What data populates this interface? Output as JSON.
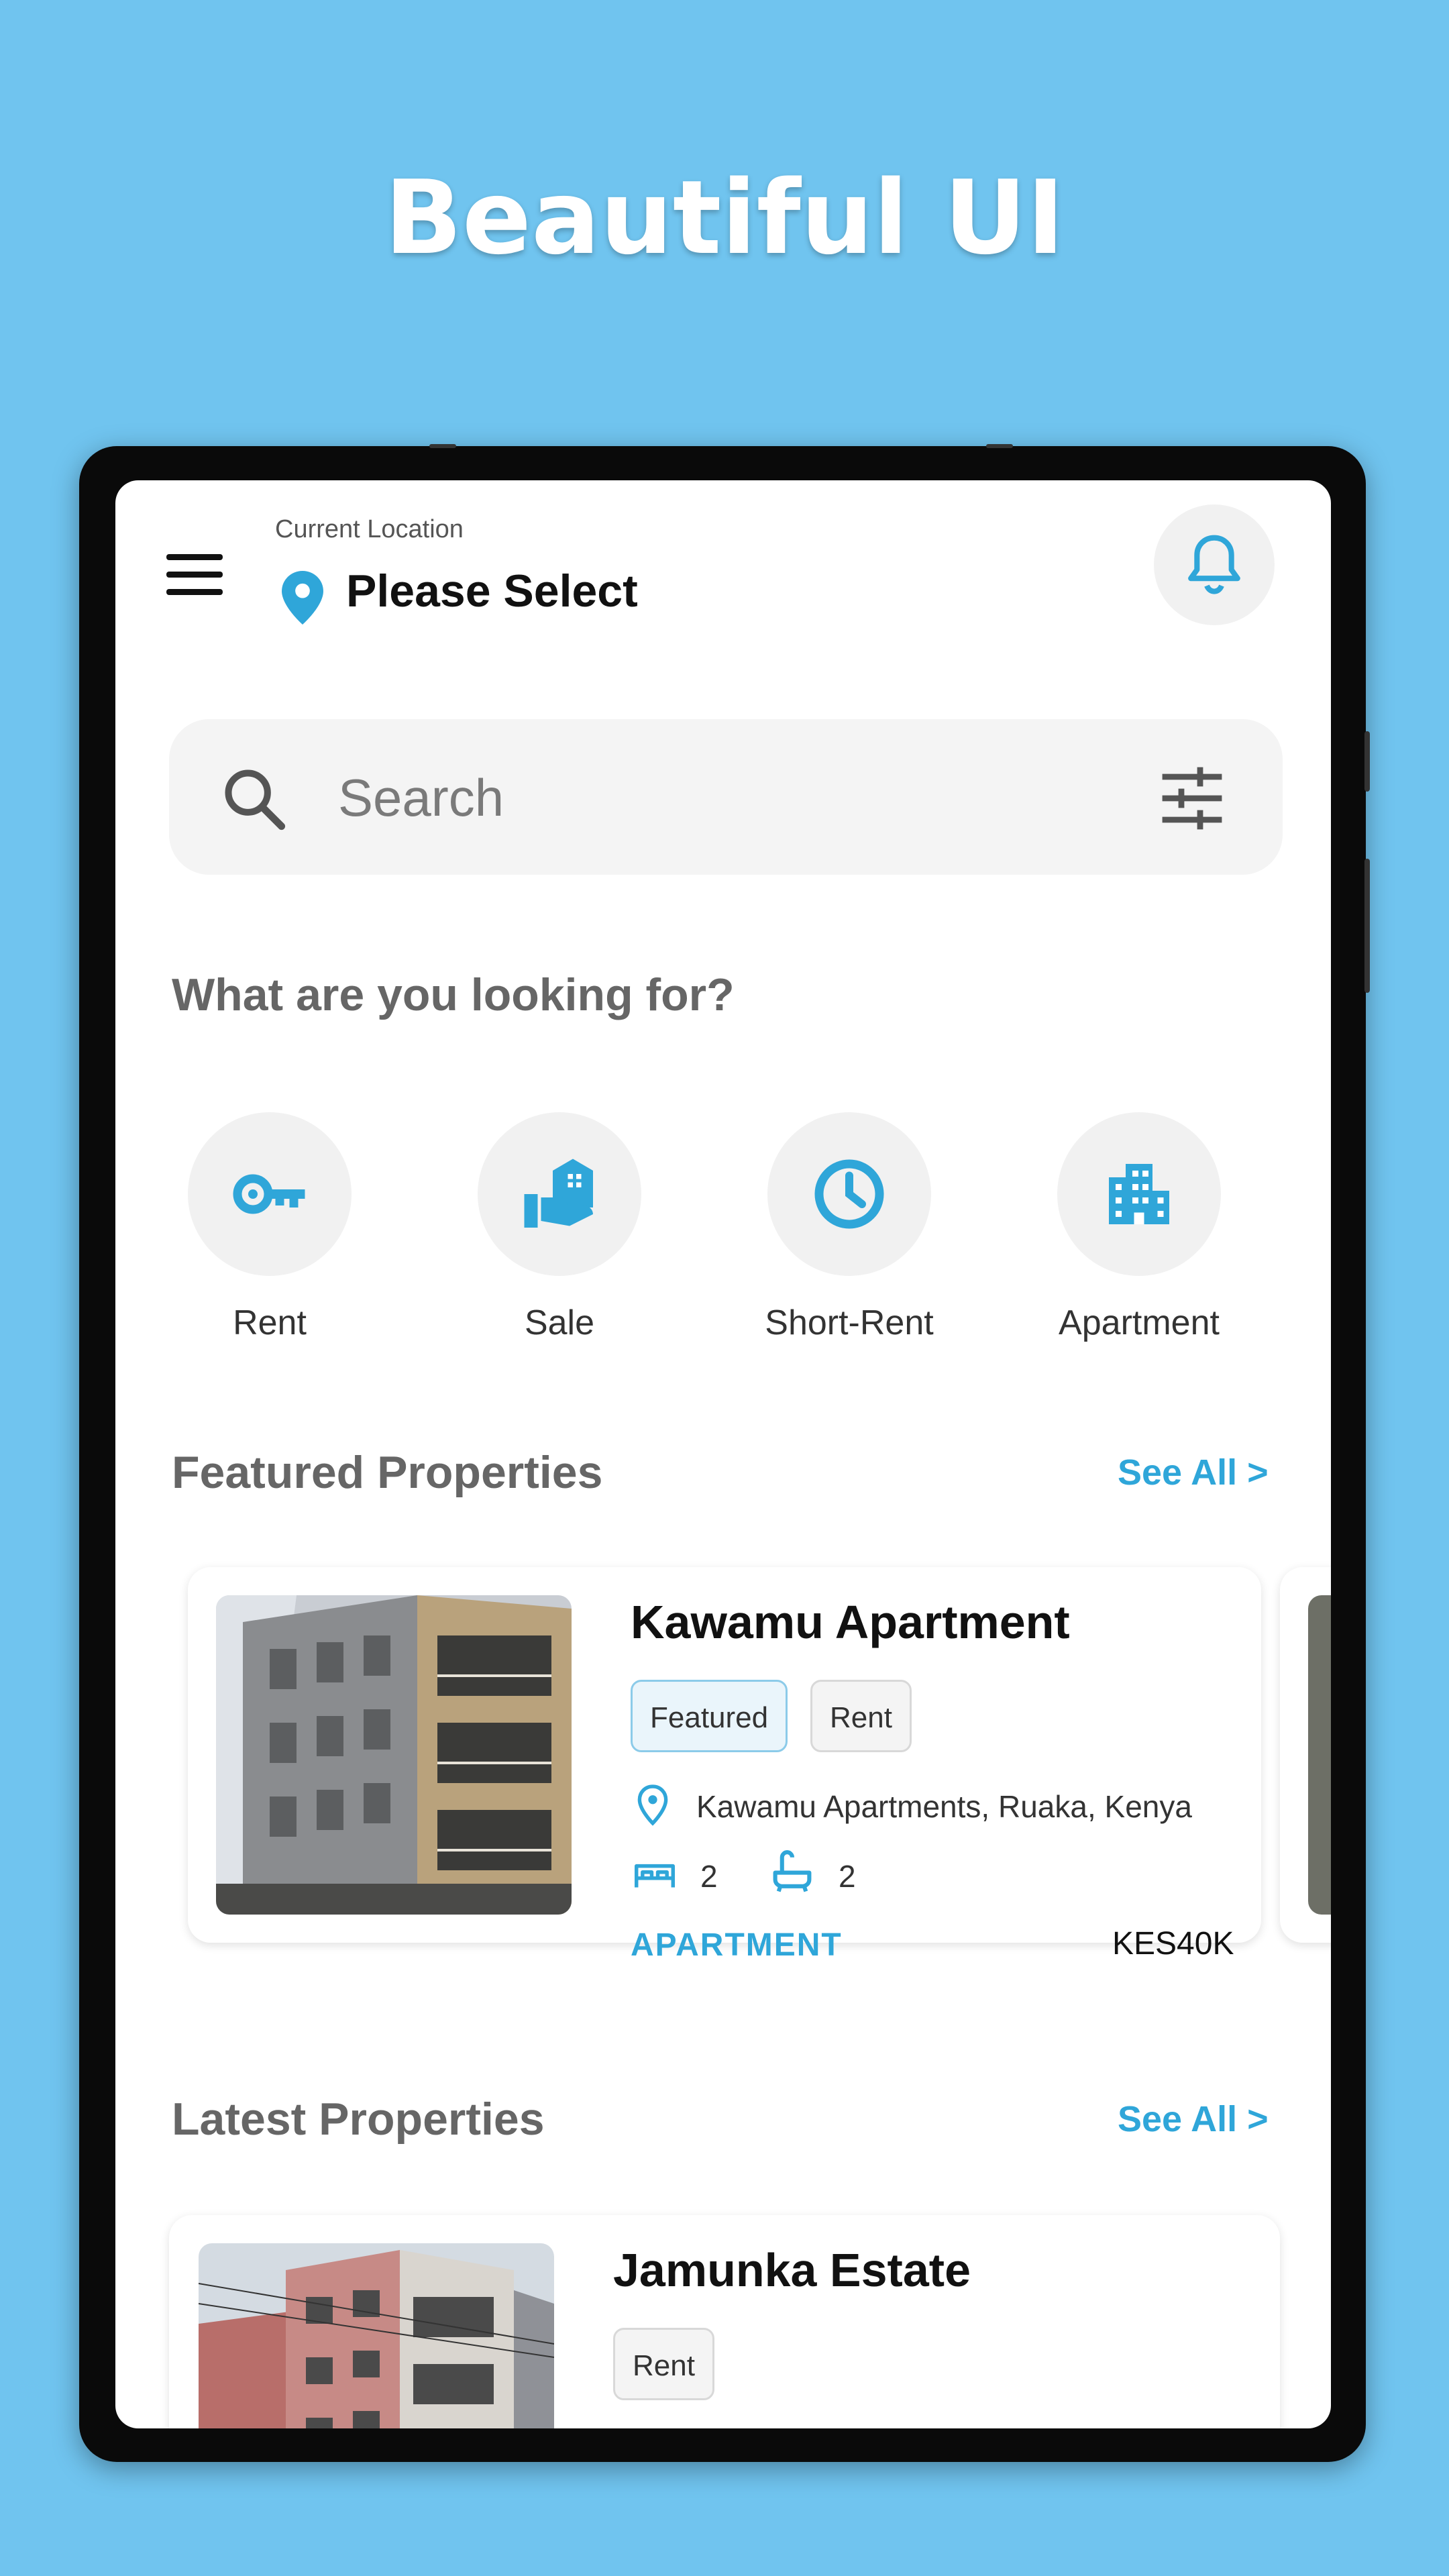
{
  "promo": {
    "title": "Beautiful UI"
  },
  "header": {
    "location_label": "Current Location",
    "location_value": "Please Select",
    "menu_icon": "hamburger-menu-icon",
    "pin_icon": "map-pin-icon",
    "bell_icon": "bell-icon"
  },
  "search": {
    "placeholder": "Search",
    "value": "",
    "icon": "search-icon",
    "filter_icon": "filter-sliders-icon"
  },
  "categories": {
    "heading": "What are you looking for?",
    "items": [
      {
        "label": "Rent",
        "icon": "key-icon"
      },
      {
        "label": "Sale",
        "icon": "house-sale-icon"
      },
      {
        "label": "Short-Rent",
        "icon": "clock-icon"
      },
      {
        "label": "Apartment",
        "icon": "building-icon"
      }
    ]
  },
  "featured": {
    "heading": "Featured Properties",
    "see_all": "See All >",
    "cards": [
      {
        "title": "Kawamu Apartment",
        "tags": [
          "Featured",
          "Rent"
        ],
        "address": "Kawamu Apartments, Ruaka, Kenya",
        "bedrooms": "2",
        "bathrooms": "2",
        "type": "APARTMENT",
        "price": "KES40K"
      }
    ]
  },
  "latest": {
    "heading": "Latest Properties",
    "see_all": "See All >",
    "cards": [
      {
        "title": "Jamunka Estate",
        "tags": [
          "Rent"
        ]
      }
    ]
  },
  "colors": {
    "background": "#70c4ef",
    "accent": "#2fa6d9",
    "screen": "#ffffff"
  }
}
